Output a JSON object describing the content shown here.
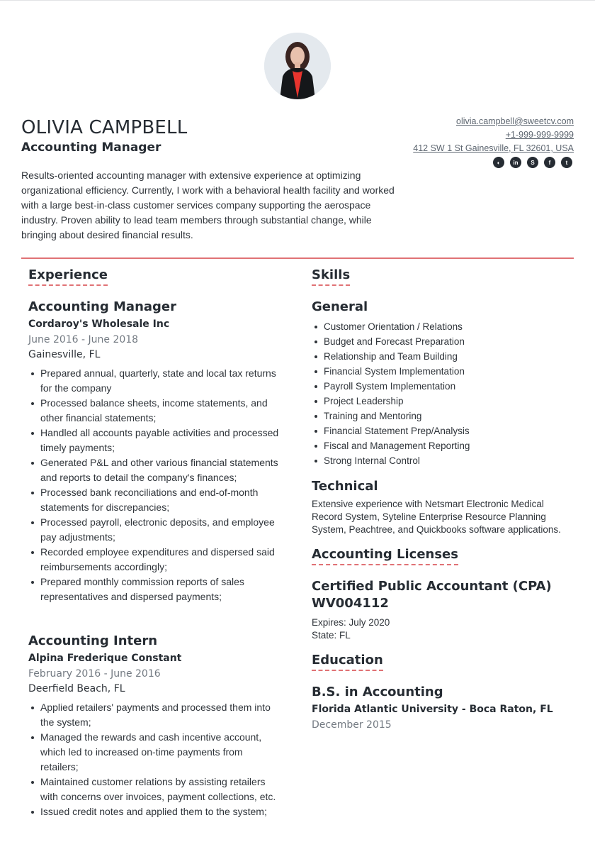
{
  "header": {
    "name": "OLIVIA CAMPBELL",
    "title": "Accounting Manager",
    "summary": "Results-oriented accounting manager with extensive experience at optimizing organizational efficiency. Currently, I work with a behavioral health facility and worked with a large best-in-class customer services company supporting the aerospace industry. Proven ability to lead team members through substantial change, while bringing about desired financial results."
  },
  "contact": {
    "email": "olivia.campbell@sweetcv.com",
    "phone": "+1-999-999-9999",
    "address": "412 SW 1 St Gainesville, FL 32601, USA",
    "socials": [
      {
        "icon": "globe-icon",
        "glyph": "◐"
      },
      {
        "icon": "linkedin-icon",
        "glyph": "in"
      },
      {
        "icon": "skype-icon",
        "glyph": "S"
      },
      {
        "icon": "facebook-icon",
        "glyph": "f"
      },
      {
        "icon": "twitter-icon",
        "glyph": "t"
      }
    ]
  },
  "colors": {
    "accent": "#e07275",
    "text": "#262c33",
    "muted": "#737a82"
  },
  "experience": {
    "title": "Experience",
    "jobs": [
      {
        "role": "Accounting Manager",
        "company": "Cordaroy's Wholesale Inc",
        "dates": "June 2016 - June 2018",
        "location": "Gainesville, FL",
        "bullets": [
          "Prepared annual, quarterly, state and local tax returns for the company",
          "Processed balance sheets, income statements, and other financial statements;",
          "Handled all accounts payable activities and processed timely payments;",
          "Generated P&L and other various financial statements and reports to detail the company's finances;",
          "Processed bank reconciliations and end-of-month statements for discrepancies;",
          "Processed payroll, electronic deposits, and employee pay adjustments;",
          "Recorded employee expenditures and dispersed said reimbursements accordingly;",
          "Prepared monthly commission reports of sales representatives and dispersed payments;"
        ]
      },
      {
        "role": "Accounting Intern",
        "company": "Alpina Frederique Constant",
        "dates": "February 2016 - June 2016",
        "location": "Deerfield Beach, FL",
        "bullets": [
          "Applied retailers' payments and processed them into the system;",
          "Managed the rewards and cash incentive account, which led to increased on-time payments from retailers;",
          "Maintained customer relations by assisting retailers with concerns over invoices, payment collections, etc.",
          "Issued credit notes and applied them to the system;"
        ]
      }
    ]
  },
  "skills": {
    "title": "Skills",
    "general_title": "General",
    "general": [
      "Customer Orientation / Relations",
      "Budget and Forecast Preparation",
      "Relationship and Team Building",
      "Financial System Implementation",
      "Payroll System Implementation",
      "Project Leadership",
      "Training and Mentoring",
      "Financial Statement Prep/Analysis",
      "Fiscal and Management Reporting",
      "Strong Internal Control"
    ],
    "technical_title": "Technical",
    "technical": "Extensive experience with Netsmart Electronic Medical Record System, Syteline Enterprise Resource Planning System, Peachtree, and Quickbooks software applications."
  },
  "licenses": {
    "title": "Accounting Licenses",
    "items": [
      {
        "name": "Certified Public Accountant (CPA) WV004112",
        "expires": "Expires: July 2020",
        "state": "State: FL"
      }
    ]
  },
  "education": {
    "title": "Education",
    "items": [
      {
        "degree": "B.S. in Accounting",
        "school": "Florida Atlantic University - Boca Raton, FL",
        "date": "December 2015"
      }
    ]
  }
}
